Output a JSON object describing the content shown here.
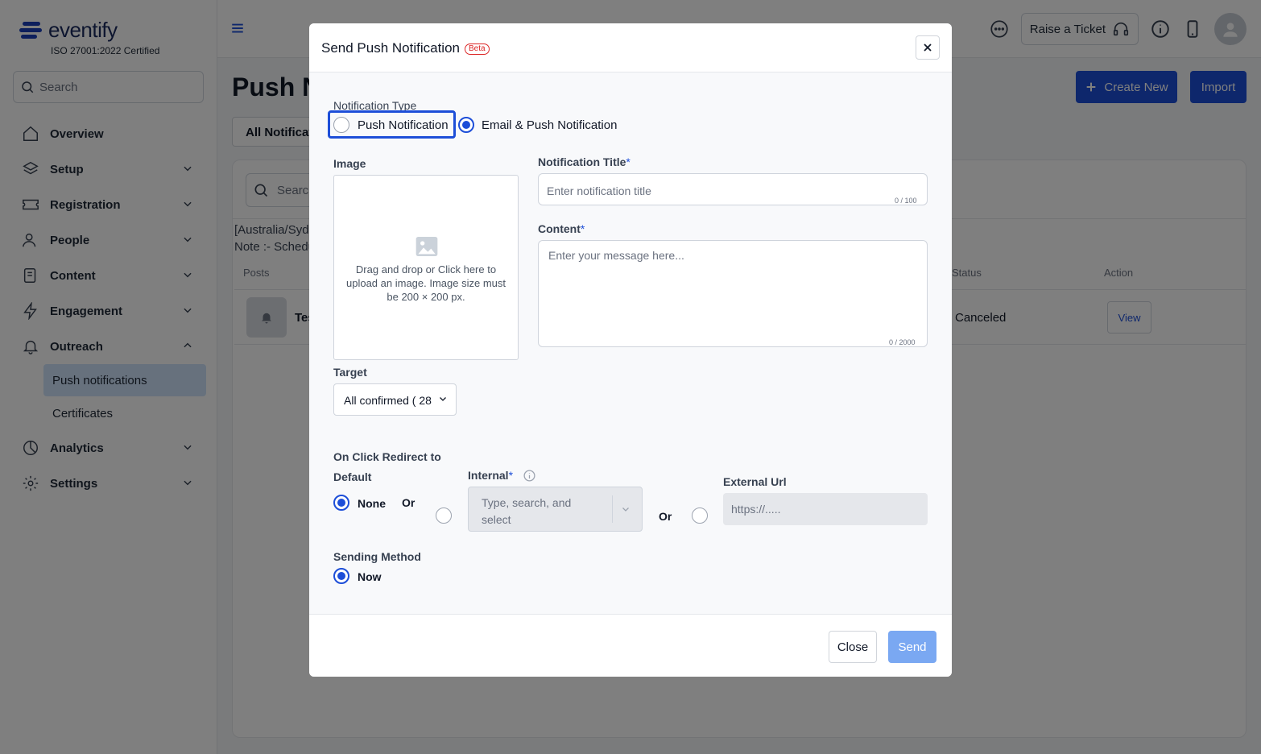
{
  "app": {
    "brand": "eventify",
    "certification": "ISO 27001:2022 Certified",
    "brand_color": "#1b3fb8"
  },
  "sidebar": {
    "search_placeholder": "Search",
    "items": [
      {
        "label": "Overview",
        "icon": "home-icon"
      },
      {
        "label": "Setup",
        "icon": "layers-icon"
      },
      {
        "label": "Registration",
        "icon": "ticket-icon"
      },
      {
        "label": "People",
        "icon": "people-icon"
      },
      {
        "label": "Content",
        "icon": "document-edit-icon"
      },
      {
        "label": "Engagement",
        "icon": "lightning-icon"
      },
      {
        "label": "Outreach",
        "icon": "bell-icon"
      },
      {
        "label": "Analytics",
        "icon": "pie-chart-icon"
      },
      {
        "label": "Settings",
        "icon": "gear-icon"
      }
    ],
    "outreach_sub": [
      "Push notifications",
      "Certificates"
    ]
  },
  "topbar": {
    "raise_ticket": "Raise a Ticket"
  },
  "page": {
    "title": "Push N",
    "create_new": "Create New",
    "import": "Import",
    "filter": "All Notificat",
    "panel_search": "Searc",
    "timezone": "[Australia/Syd",
    "note": "Note :- Schedu",
    "columns": {
      "posts": "Posts",
      "status": "Status",
      "action": "Action"
    },
    "row": {
      "title": "Tes",
      "status": "Canceled",
      "view": "View"
    }
  },
  "modal": {
    "title": "Send Push Notification",
    "badge": "Beta",
    "notification_type_label": "Notification Type",
    "type_options": [
      "Push Notification",
      "Email & Push Notification"
    ],
    "type_selected": "Email & Push Notification",
    "image_label": "Image",
    "upload_text": "Drag and drop or Click here to upload an image. Image size must be 200 × 200 px.",
    "title_label": "Notification Title",
    "required_mark": "*",
    "title_placeholder": "Enter notification title",
    "title_counter": "0 / 100",
    "content_label": "Content",
    "content_placeholder": "Enter your message here...",
    "content_counter": "0 / 2000",
    "target_label": "Target",
    "target_value": "All confirmed ( 28",
    "redirect_label": "On Click Redirect to",
    "default_label": "Default",
    "none_label": "None",
    "or_label": "Or",
    "internal_label": "Internal",
    "internal_placeholder": "Type, search, and select",
    "external_label": "External Url",
    "external_placeholder": "https://.....",
    "sending_method_label": "Sending Method",
    "sending_now": "Now",
    "close_button": "Close",
    "send_button": "Send",
    "accent": "#1d4ed8"
  }
}
